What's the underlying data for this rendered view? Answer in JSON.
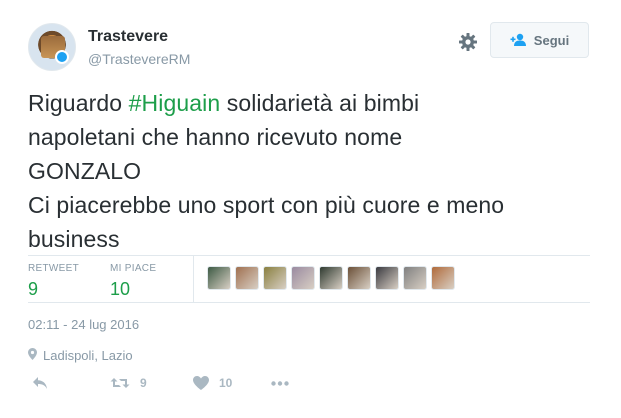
{
  "user": {
    "name": "Trastevere",
    "handle": "@TrastevereRM"
  },
  "follow_button": {
    "label": "Segui",
    "icon": "add-user-icon"
  },
  "settings": {
    "icon": "gear-icon"
  },
  "tweet": {
    "lines": [
      {
        "before": "Riguardo ",
        "hashtag": "#Higuain",
        "after": " solidarietà ai bimbi"
      },
      "napoletani che hanno ricevuto nome",
      "GONZALO",
      "Ci piacerebbe uno sport con più cuore e meno",
      "business"
    ]
  },
  "stats": {
    "retweets_label": "RETWEET",
    "retweets_value": "9",
    "likes_label": "MI PIACE",
    "likes_value": "10"
  },
  "likers": [
    {
      "name": "liker-avatar-1",
      "color": "#3d5a44"
    },
    {
      "name": "liker-avatar-2",
      "color": "#a07050"
    },
    {
      "name": "liker-avatar-3",
      "color": "#8a8040"
    },
    {
      "name": "liker-avatar-4",
      "color": "#9a8aa0"
    },
    {
      "name": "liker-avatar-5",
      "color": "#2f3a30"
    },
    {
      "name": "liker-avatar-6",
      "color": "#6b5038"
    },
    {
      "name": "liker-avatar-7",
      "color": "#3a3a40"
    },
    {
      "name": "liker-avatar-8",
      "color": "#808080"
    },
    {
      "name": "liker-avatar-9",
      "color": "#b06a3a"
    }
  ],
  "timestamp": "02:11 - 24 lug 2016",
  "location": "Ladispoli, Lazio",
  "actions": {
    "reply_icon": "reply-icon",
    "retweet_icon": "retweet-icon",
    "retweet_count": "9",
    "like_icon": "heart-icon",
    "like_count": "10",
    "more_icon": "more-dots-icon"
  },
  "colors": {
    "accent_green": "#1d9e4a",
    "muted": "#8899a6",
    "icon_grey": "#aab8c2",
    "divider": "#e1e8ed"
  }
}
